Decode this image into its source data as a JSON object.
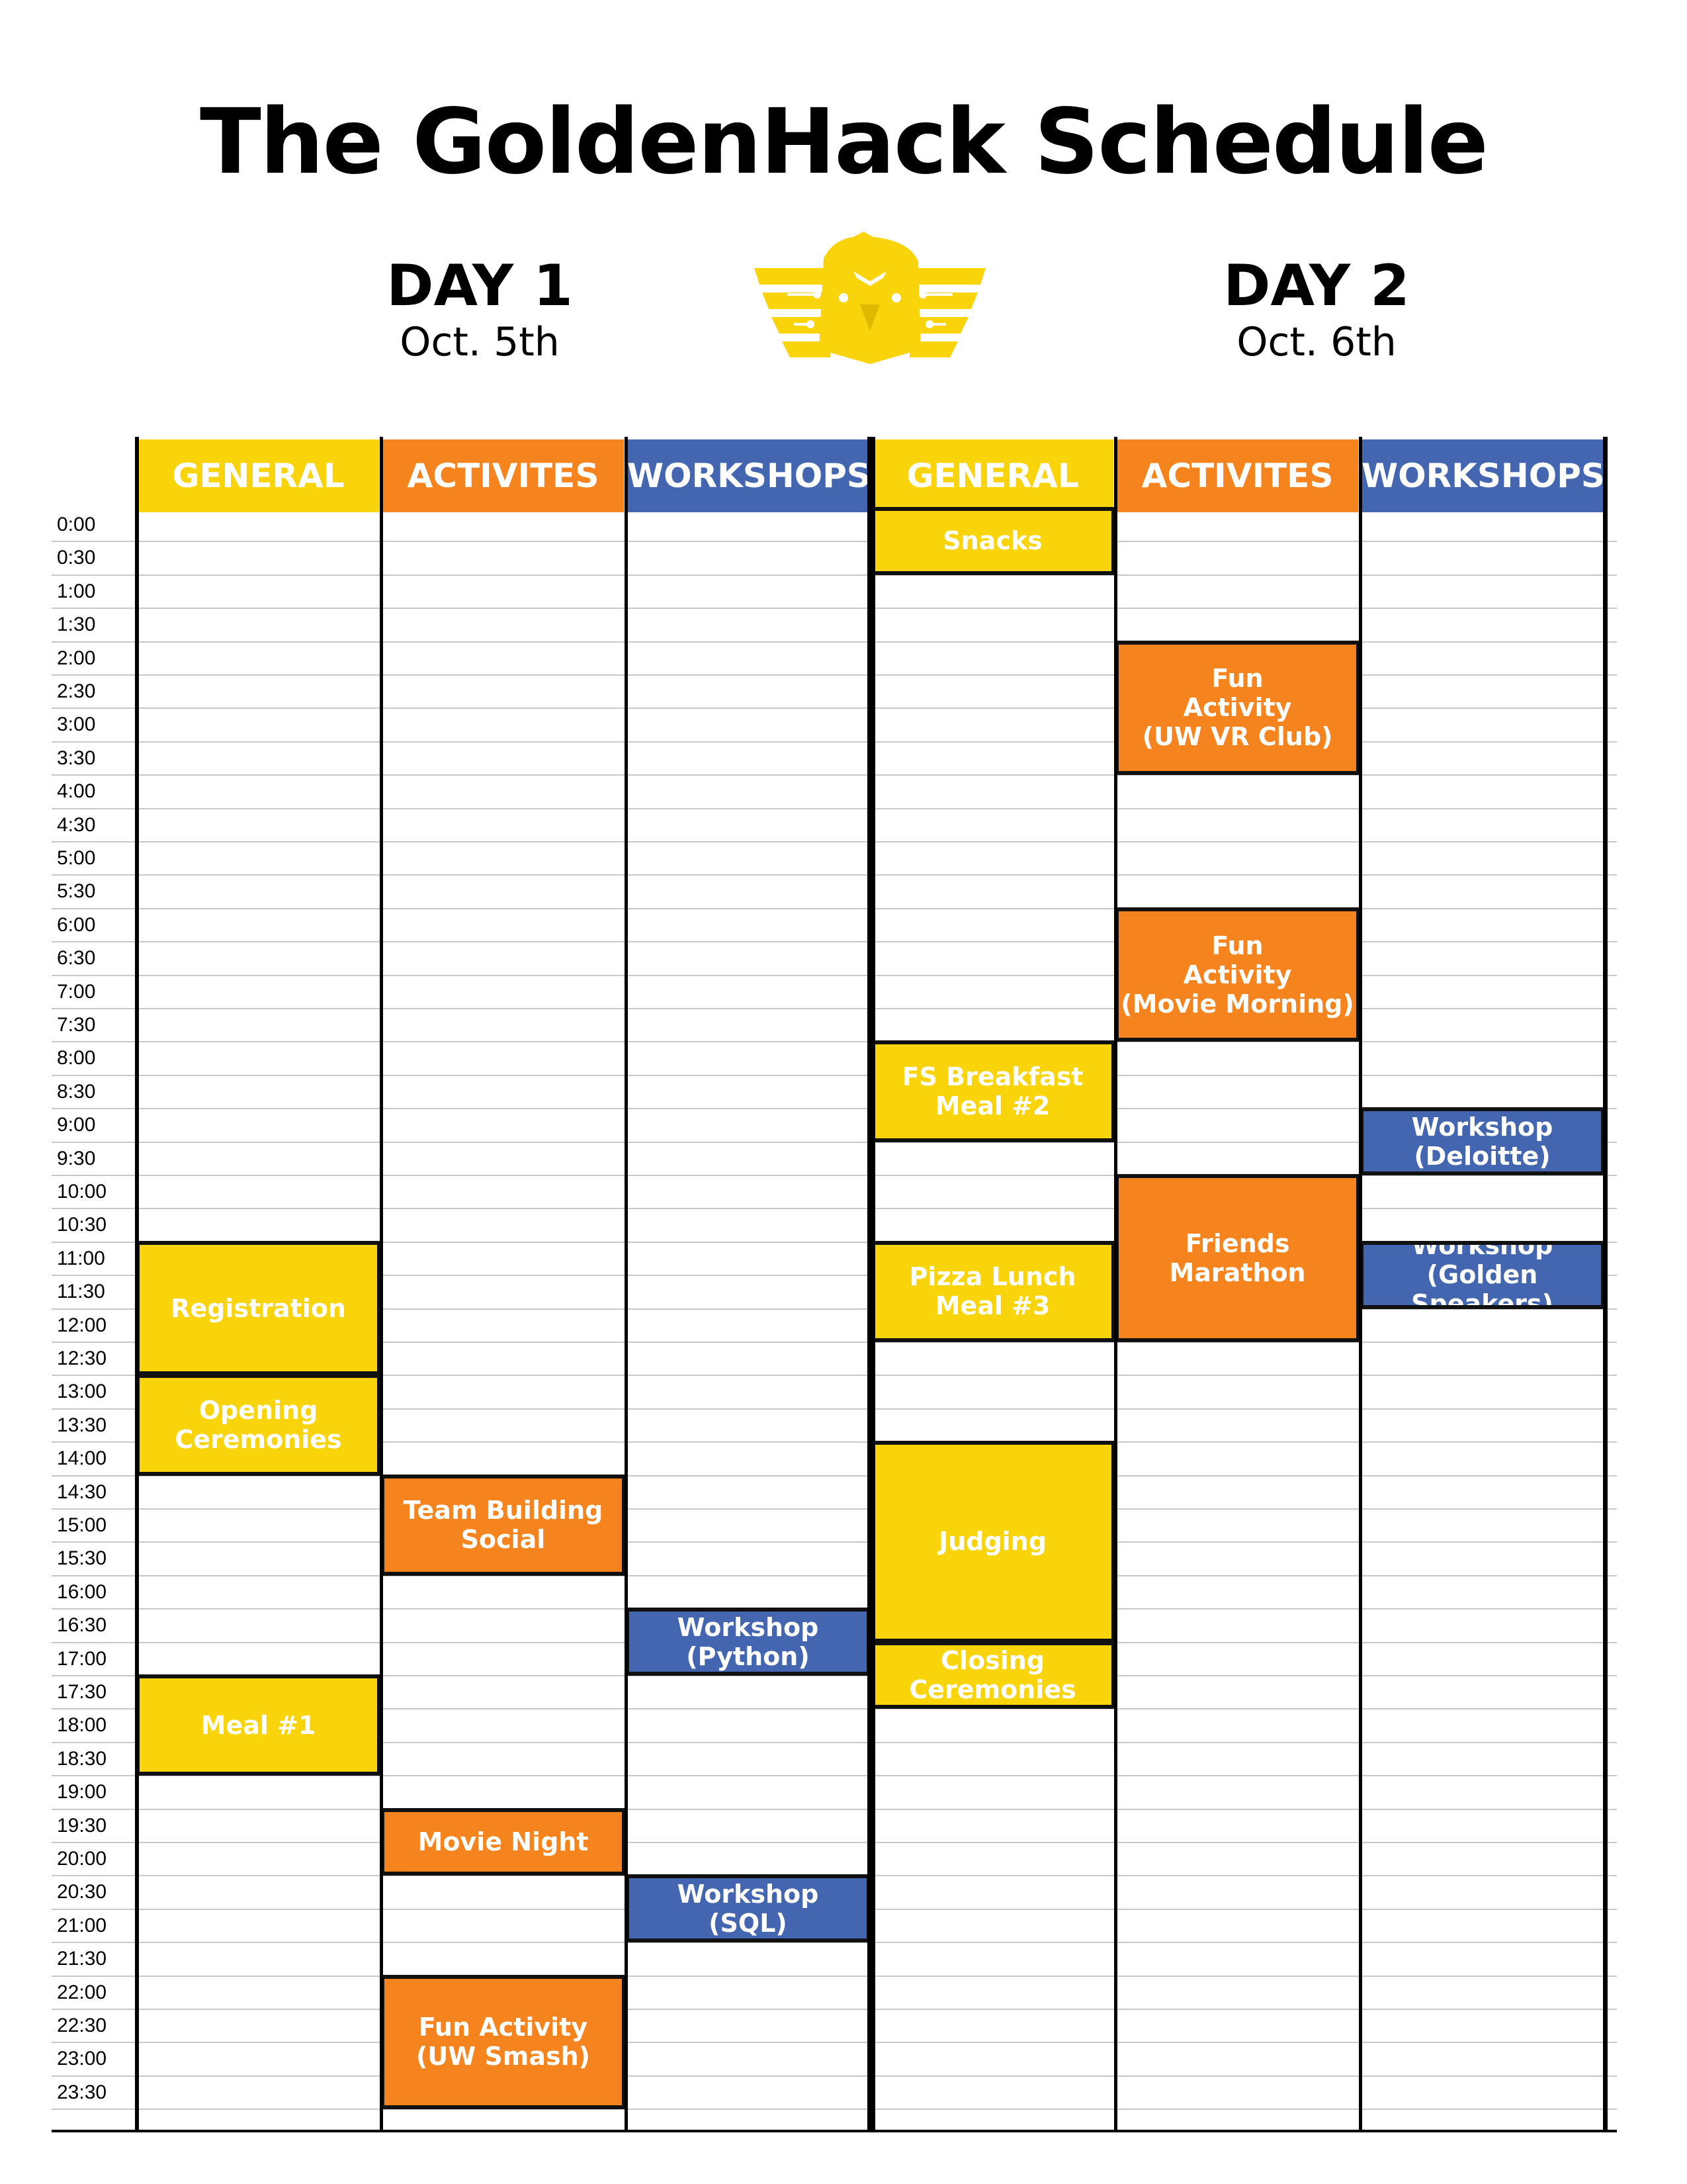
{
  "title": "The GoldenHack Schedule",
  "days": [
    {
      "title": "DAY 1",
      "date": "Oct. 5th"
    },
    {
      "title": "DAY 2",
      "date": "Oct. 6th"
    }
  ],
  "logo": {
    "icon": "golden-eagle-wings-logo",
    "color": "#FAD40A"
  },
  "colors": {
    "general": "#FAD40A",
    "activities": "#F5841F",
    "workshops": "#4466B0"
  },
  "columns": [
    {
      "label": "GENERAL",
      "type": "general"
    },
    {
      "label": "ACTIVITES",
      "type": "activities"
    },
    {
      "label": "WORKSHOPS",
      "type": "workshops"
    },
    {
      "label": "GENERAL",
      "type": "general"
    },
    {
      "label": "ACTIVITES",
      "type": "activities"
    },
    {
      "label": "WORKSHOPS",
      "type": "workshops"
    }
  ],
  "times": [
    "0:00",
    "0:30",
    "1:00",
    "1:30",
    "2:00",
    "2:30",
    "3:00",
    "3:30",
    "4:00",
    "4:30",
    "5:00",
    "5:30",
    "6:00",
    "6:30",
    "7:00",
    "7:30",
    "8:00",
    "8:30",
    "9:00",
    "9:30",
    "10:00",
    "10:30",
    "11:00",
    "11:30",
    "12:00",
    "12:30",
    "13:00",
    "13:30",
    "14:00",
    "14:30",
    "15:00",
    "15:30",
    "16:00",
    "16:30",
    "17:00",
    "17:30",
    "18:00",
    "18:30",
    "19:00",
    "19:30",
    "20:00",
    "20:30",
    "21:00",
    "21:30",
    "22:00",
    "22:30",
    "23:00",
    "23:30"
  ],
  "events": [
    {
      "col": 0,
      "start": "11:00",
      "end": "13:00",
      "label": "Registration"
    },
    {
      "col": 0,
      "start": "13:00",
      "end": "14:30",
      "label": "Opening\nCeremonies"
    },
    {
      "col": 0,
      "start": "17:30",
      "end": "19:00",
      "label": "Meal #1"
    },
    {
      "col": 1,
      "start": "14:30",
      "end": "16:00",
      "label": "Team Building\nSocial"
    },
    {
      "col": 1,
      "start": "19:30",
      "end": "20:30",
      "label": "Movie Night"
    },
    {
      "col": 1,
      "start": "22:00",
      "end": "24:00",
      "label": "Fun Activity\n(UW Smash)"
    },
    {
      "col": 2,
      "start": "16:30",
      "end": "17:30",
      "label": "Workshop\n(Python)"
    },
    {
      "col": 2,
      "start": "20:30",
      "end": "21:30",
      "label": "Workshop\n(SQL)"
    },
    {
      "col": 3,
      "start": "0:00",
      "end": "1:00",
      "label": "Snacks"
    },
    {
      "col": 3,
      "start": "8:00",
      "end": "9:30",
      "label": "FS Breakfast\nMeal #2"
    },
    {
      "col": 3,
      "start": "11:00",
      "end": "12:30",
      "label": "Pizza Lunch\nMeal #3"
    },
    {
      "col": 3,
      "start": "14:00",
      "end": "17:00",
      "label": "Judging"
    },
    {
      "col": 3,
      "start": "17:00",
      "end": "18:00",
      "label": "Closing\nCeremonies"
    },
    {
      "col": 4,
      "start": "2:00",
      "end": "4:00",
      "label": "Fun\nActivity\n(UW VR Club)"
    },
    {
      "col": 4,
      "start": "6:00",
      "end": "8:00",
      "label": "Fun\nActivity\n(Movie Morning)"
    },
    {
      "col": 4,
      "start": "10:00",
      "end": "12:30",
      "label": "Friends\nMarathon"
    },
    {
      "col": 5,
      "start": "9:00",
      "end": "10:00",
      "label": "Workshop\n(Deloitte)"
    },
    {
      "col": 5,
      "start": "11:00",
      "end": "12:00",
      "label": "Workshop\n(Golden Speakers)"
    }
  ]
}
